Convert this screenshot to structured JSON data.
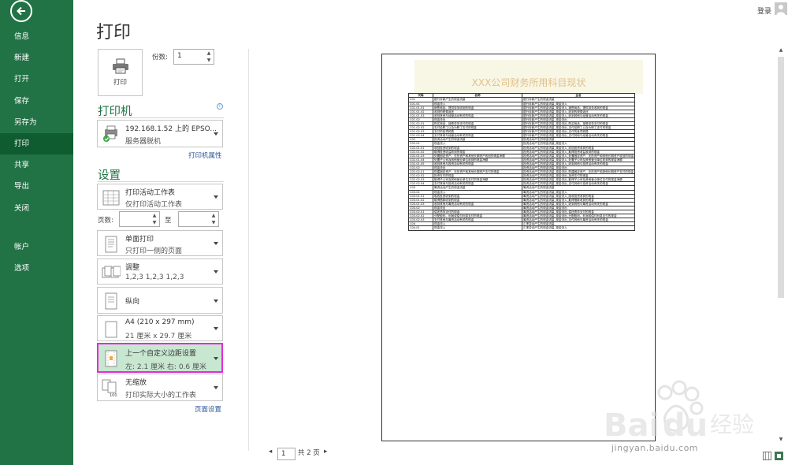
{
  "sidebar": {
    "items": [
      "信息",
      "新建",
      "打开",
      "保存",
      "另存为",
      "打印",
      "共享",
      "导出",
      "关闭"
    ],
    "items2": [
      "帐户",
      "选项"
    ],
    "active_index": 5
  },
  "header": {
    "login": "登录"
  },
  "title": "打印",
  "print_button": "打印",
  "copies": {
    "label": "份数:",
    "value": "1"
  },
  "printer": {
    "section": "打印机",
    "name": "192.168.1.52 上的 EPSO...",
    "status": "服务器脱机",
    "properties_link": "打印机属性"
  },
  "settings": {
    "section": "设置",
    "print_what": {
      "title": "打印活动工作表",
      "subtitle": "仅打印活动工作表"
    },
    "pages": {
      "label": "页数:",
      "to": "至"
    },
    "sides": {
      "title": "单面打印",
      "subtitle": "只打印一侧的页面"
    },
    "collate": {
      "title": "调整",
      "subtitle": "1,2,3    1,2,3    1,2,3"
    },
    "orientation": {
      "title": "纵向"
    },
    "paper": {
      "title": "A4 (210 x 297 mm)",
      "subtitle": "21 厘米 x 29.7 厘米"
    },
    "margins": {
      "title": "上一个自定义边距设置",
      "subtitle": "左: 2.1 厘米    右: 0.6 厘米"
    },
    "scaling": {
      "title": "无缩放",
      "subtitle": "打印实际大小的工作表"
    },
    "page_setup_link": "页面设置"
  },
  "preview": {
    "sheet_title": "XXX公司财务所用科目现状",
    "columns": [
      "代码",
      "名称",
      "全名"
    ],
    "rows": [
      [
        "C01",
        "银行存款产生的现金流量",
        "银行存款产生的现金流量"
      ],
      [
        "C01.01",
        "现金流入",
        "银行存款产生的现金流量_现金流入"
      ],
      [
        "C01.01.01",
        "销售商品、提供劳务收到的现金",
        "银行存款产生的现金流量_现金流入_销售商品、提供劳务收到的现金"
      ],
      [
        "C01.01.02",
        "收到的税费返还",
        "银行存款产生的现金流量_现金流入_收到的税费返还"
      ],
      [
        "C01.01.03",
        "收到其他与经营活动有关的现金",
        "银行存款产生的现金流量_现金流入_收到其他与经营活动有关的现金"
      ],
      [
        "C01.02",
        "现金流出",
        "银行存款产生的现金流量_现金流出"
      ],
      [
        "C01.02.01",
        "购买商品、接受劳务支付的现金",
        "银行存款产生的现金流量_现金流出_购买商品、接受劳务支付的现金"
      ],
      [
        "C01.02.02",
        "支付给职工以及为职工支付的现金",
        "银行存款产生的现金流量_现金流出_支付给职工以及为职工支付的现金"
      ],
      [
        "C01.02.03",
        "支付的各项税费",
        "银行存款产生的现金流量_现金流出_支付的各项税费"
      ],
      [
        "C01.02.04",
        "支付其他与经营活动有关的现金",
        "银行存款产生的现金流量_现金流出_支付其他与经营活动有关的现金"
      ],
      [
        "C02",
        "投资活动产生的现金流量",
        "投资活动产生的现金流量"
      ],
      [
        "C02.01",
        "现金流入",
        "投资活动产生的现金流量_现金流入"
      ],
      [
        "C02.01.01",
        "收回投资收到的现金",
        "投资活动产生的现金流量_现金流入_收回投资收到的现金"
      ],
      [
        "C02.01.02",
        "取得投资收益收到的现金",
        "投资活动产生的现金流量_现金流入_取得投资收益收到的现金"
      ],
      [
        "C02.01.03",
        "处置固定资产、无形资产和其他长期资产收回的现金净额",
        "投资活动产生的现金流量_现金流入_处置固定资产、无形资产和其他长期资产收回的现金净额"
      ],
      [
        "C02.01.04",
        "处置子公司及其他营业单位收到的现金净额",
        "投资活动产生的现金流量_现金流入_处置子公司及其他营业单位收到的现金净额"
      ],
      [
        "C02.01.05",
        "收到其他与投资活动有关的现金",
        "投资活动产生的现金流量_现金流入_收到其他与投资活动有关的现金"
      ],
      [
        "C02.02",
        "现金流出",
        "投资活动产生的现金流量_现金流出"
      ],
      [
        "C02.02.01",
        "购建固定资产、无形资产和其他长期资产支付的现金",
        "投资活动产生的现金流量_现金流出_购建固定资产、无形资产和其他长期资产支付的现金"
      ],
      [
        "C02.02.02",
        "投资支付的现金",
        "投资活动产生的现金流量_现金流出_投资支付的现金"
      ],
      [
        "C02.02.03",
        "取得子公司及其他营业单位支付的现金净额",
        "投资活动产生的现金流量_现金流出_取得子公司及其他营业单位支付的现金净额"
      ],
      [
        "C02.02.04",
        "支付其他与投资活动有关的现金",
        "投资活动产生的现金流量_现金流出_支付其他与投资活动有关的现金"
      ],
      [
        "C03",
        "筹资活动产生的现金流量",
        "筹资活动产生的现金流量"
      ],
      [
        "C03.01",
        "现金流入",
        "筹资活动产生的现金流量_现金流入"
      ],
      [
        "C03.01.01",
        "吸收投资收到的现金",
        "筹资活动产生的现金流量_现金流入_吸收投资收到的现金"
      ],
      [
        "C03.01.02",
        "取得借款收到的现金",
        "筹资活动产生的现金流量_现金流入_取得借款收到的现金"
      ],
      [
        "C03.01.03",
        "收到其他与筹资活动有关的现金",
        "筹资活动产生的现金流量_现金流入_收到其他与筹资活动有关的现金"
      ],
      [
        "C03.02",
        "现金流出",
        "筹资活动产生的现金流量_现金流出"
      ],
      [
        "C03.02.01",
        "偿还债务支付的现金",
        "筹资活动产生的现金流量_现金流出_偿还债务支付的现金"
      ],
      [
        "C03.02.02",
        "分配股利、利润或偿付利息支付的现金",
        "筹资活动产生的现金流量_现金流出_分配股利、利润或偿付利息支付的现金"
      ],
      [
        "C03.02.03",
        "支付其他与筹资活动有关的现金",
        "筹资活动产生的现金流量_现金流出_支付其他与筹资活动有关的现金"
      ],
      [
        "C04",
        "现金流入",
        "汇率变动产生的现金流量"
      ],
      [
        "C04.01",
        "现金流入",
        "汇率变动产生的现金流量_现金流入"
      ]
    ]
  },
  "pager": {
    "current": "1",
    "total": "共 2 页"
  },
  "watermark": "jingyan.baidu.com"
}
